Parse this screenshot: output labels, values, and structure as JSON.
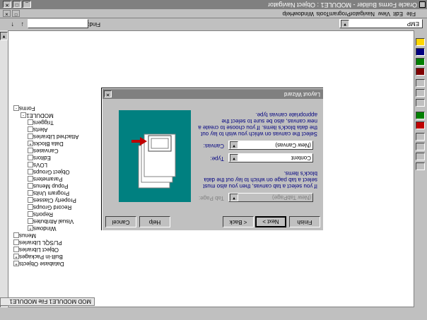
{
  "title_bar": {
    "text": "Oracle Forms Builder - MODULE1 : Object Navigator"
  },
  "menu": [
    "File",
    "Edit",
    "View",
    "Navigator",
    "Program",
    "Tools",
    "Window",
    "Help"
  ],
  "window_title": "MOD MODULE1 File MODULE1",
  "navigator": {
    "scope_value": "EMP",
    "find_label": "Find:",
    "find_value": "",
    "tree": [
      {
        "label": "Forms",
        "indent": 0,
        "marker": "-"
      },
      {
        "label": "MODULE1",
        "indent": 1,
        "marker": "-"
      },
      {
        "label": "Triggers",
        "indent": 2,
        "marker": ""
      },
      {
        "label": "Alerts",
        "indent": 2,
        "marker": ""
      },
      {
        "label": "Attached Libraries",
        "indent": 2,
        "marker": ""
      },
      {
        "label": "Data Blocks",
        "indent": 2,
        "marker": "+"
      },
      {
        "label": "Canvases",
        "indent": 2,
        "marker": ""
      },
      {
        "label": "Editors",
        "indent": 2,
        "marker": ""
      },
      {
        "label": "LOVs",
        "indent": 2,
        "marker": ""
      },
      {
        "label": "Object Groups",
        "indent": 2,
        "marker": ""
      },
      {
        "label": "Parameters",
        "indent": 2,
        "marker": ""
      },
      {
        "label": "Popup Menus",
        "indent": 2,
        "marker": ""
      },
      {
        "label": "Program Units",
        "indent": 2,
        "marker": ""
      },
      {
        "label": "Property Classes",
        "indent": 2,
        "marker": ""
      },
      {
        "label": "Record Groups",
        "indent": 2,
        "marker": ""
      },
      {
        "label": "Reports",
        "indent": 2,
        "marker": ""
      },
      {
        "label": "Visual Attributes",
        "indent": 2,
        "marker": ""
      },
      {
        "label": "Windows",
        "indent": 2,
        "marker": "+"
      },
      {
        "label": "Menus",
        "indent": 0,
        "marker": ""
      },
      {
        "label": "PL/SQL Libraries",
        "indent": 0,
        "marker": ""
      },
      {
        "label": "Object Libraries",
        "indent": 0,
        "marker": ""
      },
      {
        "label": "Built-in Packages",
        "indent": 0,
        "marker": "+"
      },
      {
        "label": "Database Objects",
        "indent": 0,
        "marker": "+"
      }
    ]
  },
  "wizard": {
    "title": "Layout Wizard",
    "intro": "Select the canvas on which you wish to lay out the data block's items. If you choose to create a new canvas, also be sure to select the appropriate canvas type.",
    "canvas_label": "Canvas:",
    "canvas_value": "(New Canvas)",
    "type_label": "Type:",
    "type_value": "Content",
    "tab_note": "If you select a tab canvas, then you also must select a tab page on which to lay out the data block's items.",
    "tab_page_label": "Tab Page:",
    "tab_page_value": "(New TabPage)",
    "buttons": {
      "cancel": "Cancel",
      "help": "Help",
      "back": "< Back",
      "next": "Next >",
      "finish": "Finish"
    },
    "colors": {
      "teal": "#008080",
      "arrow": "#c00000",
      "text": "#000080"
    }
  }
}
